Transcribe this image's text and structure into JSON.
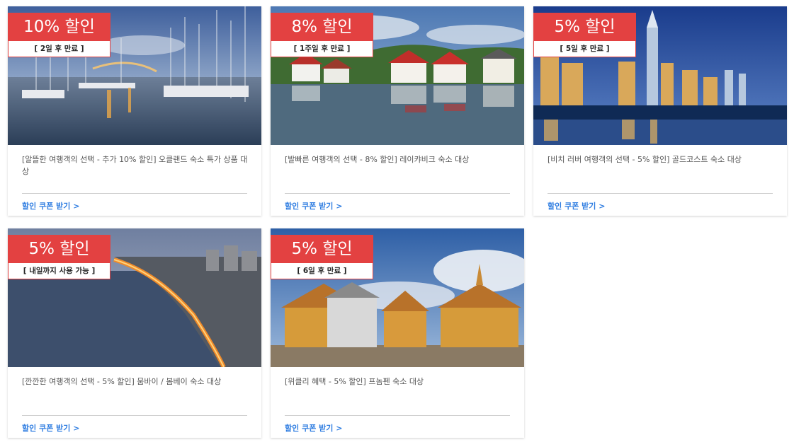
{
  "colors": {
    "badge": "#e34141",
    "link": "#2f7de1",
    "text": "#555555"
  },
  "deals": [
    {
      "discount": "10% 할인",
      "expiry": "[ 2일 후 만료 ]",
      "description": "[알뜰한 여행객의 선택 - 추가 10% 할인] 오클랜드 숙소 특가 상품 대상",
      "cta": "할인 쿠폰 받기 >",
      "photo": "auckland-marina-photo"
    },
    {
      "discount": "8% 할인",
      "expiry": "[ 1주일 후 만료 ]",
      "description": "[발빠른 여행객의 선택 - 8% 할인] 레이캬비크 숙소 대상",
      "cta": "할인 쿠폰 받기 >",
      "photo": "reykjavik-lakeside-houses-photo"
    },
    {
      "discount": "5% 할인",
      "expiry": "[ 5일 후 만료 ]",
      "description": "[비치 러버 여행객의 선택 - 5% 할인] 골드코스트 숙소 대상",
      "cta": "할인 쿠폰 받기 >",
      "photo": "gold-coast-skyline-photo"
    },
    {
      "discount": "5% 할인",
      "expiry": "[ 내일까지 사용 가능 ]",
      "description": "[깐깐한 여행객의 선택 - 5% 할인] 뭄바이 / 봄베이 숙소 대상",
      "cta": "할인 쿠폰 받기 >",
      "photo": "mumbai-marine-drive-photo"
    },
    {
      "discount": "5% 할인",
      "expiry": "[ 6일 후 만료 ]",
      "description": "[위클리 혜택 - 5% 할인] 프놈펜 숙소 대상",
      "cta": "할인 쿠폰 받기 >",
      "photo": "phnom-penh-palace-photo"
    }
  ]
}
